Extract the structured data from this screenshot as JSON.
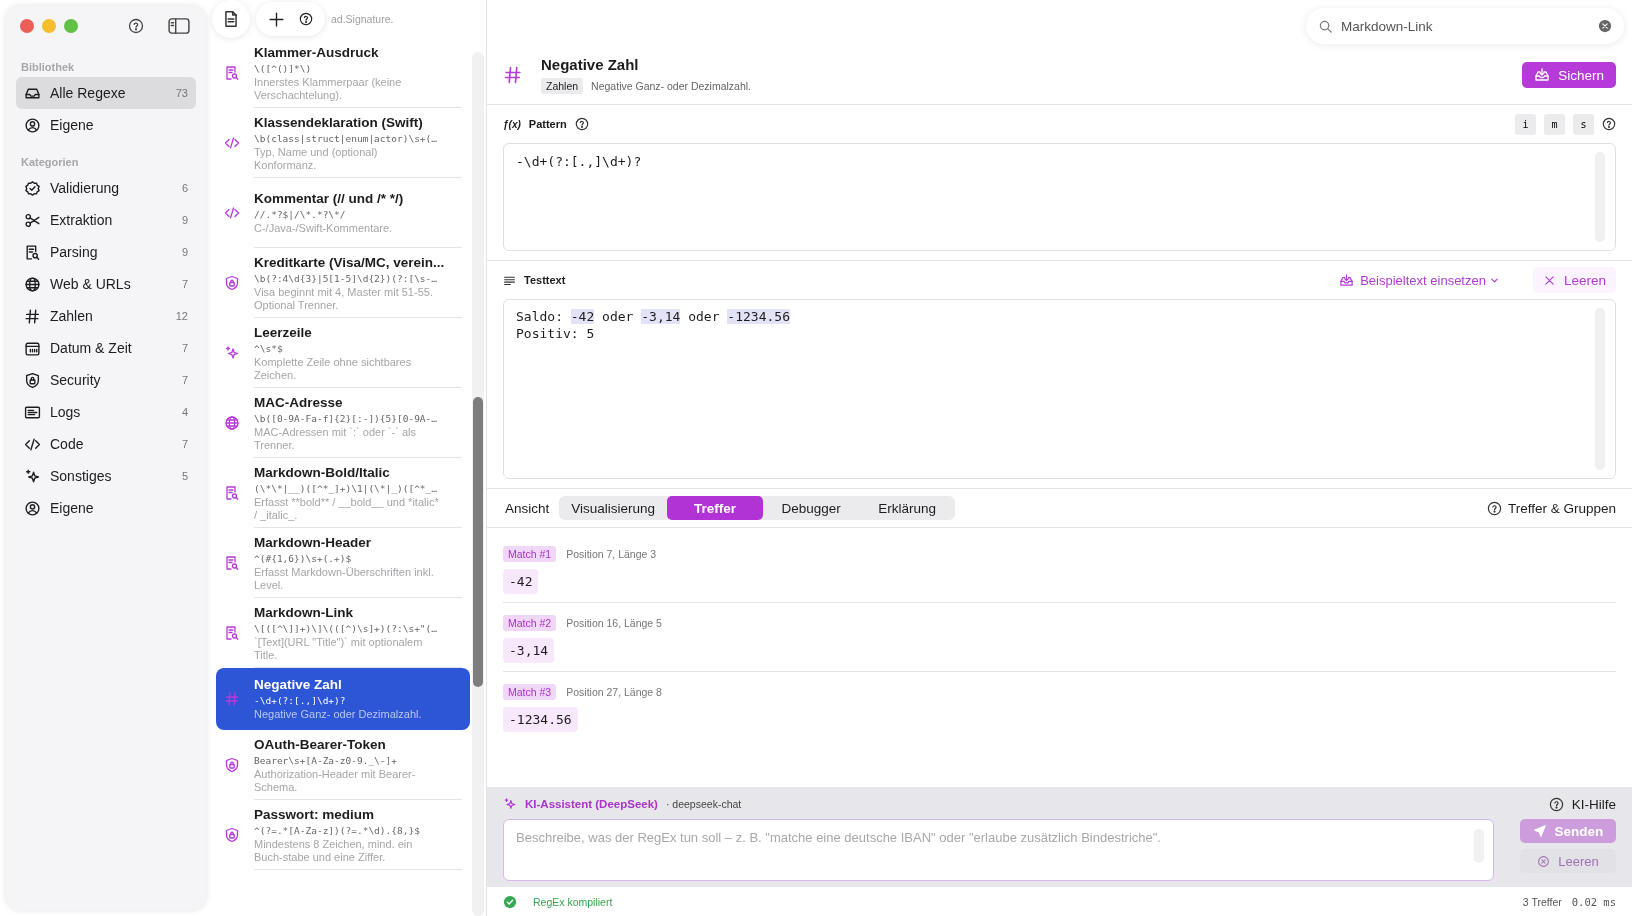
{
  "sidebar": {
    "sections": [
      {
        "title": "Bibliothek",
        "items": [
          {
            "label": "Alle Regexe",
            "count": "73",
            "selected": true
          },
          {
            "label": "Eigene",
            "selected": false
          }
        ]
      },
      {
        "title": "Kategorien",
        "items": [
          {
            "label": "Validierung",
            "count": "6",
            "selected": false
          },
          {
            "label": "Extraktion",
            "count": "9",
            "selected": false
          },
          {
            "label": "Parsing",
            "count": "9",
            "selected": false
          },
          {
            "label": "Web & URLs",
            "count": "7",
            "selected": false
          },
          {
            "label": "Zahlen",
            "count": "12",
            "selected": false
          },
          {
            "label": "Datum & Zeit",
            "count": "7",
            "selected": false
          },
          {
            "label": "Security",
            "count": "7",
            "selected": false
          },
          {
            "label": "Logs",
            "count": "4",
            "selected": false
          },
          {
            "label": "Code",
            "count": "7",
            "selected": false
          },
          {
            "label": "Sonstiges",
            "count": "5",
            "selected": false
          },
          {
            "label": "Eigene",
            "selected": false
          }
        ]
      }
    ]
  },
  "list": {
    "top_fragment": "ad.Signature.",
    "items": [
      {
        "kind": "parsing",
        "title": "Klammer-Ausdruck",
        "pattern": "\\([^()]*\\)",
        "description": "Innerstes Klammerpaar (keine Verschachtelung).",
        "selected": false
      },
      {
        "kind": "code",
        "title": "Klassendeklaration (Swift)",
        "pattern": "\\b(class|struct|enum|actor)\\s+(…",
        "description": "Typ, Name und (optional) Konformanz.",
        "selected": false
      },
      {
        "kind": "code",
        "title": "Kommentar (// und /* */)",
        "pattern": "//.*?$|/\\*.*?\\*/",
        "description": "C-/Java-/Swift-Kommentare.",
        "selected": false
      },
      {
        "kind": "security",
        "title": "Kreditkarte (Visa/MC, verein...",
        "pattern": "\\b(?:4\\d{3}|5[1-5]\\d{2})(?:[\\s-…",
        "description": "Visa beginnt mit 4, Master mit 51-55. Optional Trenner.",
        "selected": false
      },
      {
        "kind": "misc",
        "title": "Leerzeile",
        "pattern": "^\\s*$",
        "description": "Komplette Zeile ohne sichtbares Zeichen.",
        "selected": false
      },
      {
        "kind": "web",
        "title": "MAC-Adresse",
        "pattern": "\\b([0-9A-Fa-f]{2}[:-]){5}[0-9A-…",
        "description": "MAC-Adressen mit `:` oder `-` als Trenner.",
        "selected": false
      },
      {
        "kind": "parsing",
        "title": "Markdown-Bold/Italic",
        "pattern": "(\\*\\*|__)([^*_]+)\\1|(\\*|_)([^*_…",
        "description": "Erfasst **bold** / __bold__ und *italic* / _italic_.",
        "selected": false
      },
      {
        "kind": "parsing",
        "title": "Markdown-Header",
        "pattern": "^(#{1,6})\\s+(.+)$",
        "description": "Erfasst Markdown-Überschriften inkl. Level.",
        "selected": false
      },
      {
        "kind": "parsing",
        "title": "Markdown-Link",
        "pattern": "\\[([^\\]]+)\\]\\(([^)\\s]+)(?:\\s+\"(…",
        "description": "`[Text](URL \"Title\")` mit optionalem Title.",
        "selected": false
      },
      {
        "kind": "number",
        "title": "Negative Zahl",
        "pattern": "-\\d+(?:[.,]\\d+)?",
        "description": "Negative Ganz- oder Dezimalzahl.",
        "selected": true
      },
      {
        "kind": "security",
        "title": "OAuth-Bearer-Token",
        "pattern": "Bearer\\s+[A-Za-z0-9._\\-]+",
        "description": "Authorization-Header mit Bearer-Schema.",
        "selected": false
      },
      {
        "kind": "security",
        "title": "Passwort: medium",
        "pattern": "^(?=.*[A-Za-z])(?=.*\\d).{8,}$",
        "description": "Mindestens 8 Zeichen, mind. ein Buch-stabe und eine Ziffer.",
        "selected": false
      }
    ]
  },
  "search": {
    "value": "Markdown-Link"
  },
  "detail": {
    "title": "Negative Zahl",
    "tag": "Zahlen",
    "description": "Negative Ganz- oder Dezimalzahl.",
    "save": "Sichern"
  },
  "pattern": {
    "icon_text": "ƒ(x)",
    "label": "Pattern",
    "flags": [
      "i",
      "m",
      "s"
    ],
    "value": "-\\d+(?:[.,]\\d+)?"
  },
  "testtext": {
    "label": "Testtext",
    "sample_button": "Beispieltext einsetzen",
    "clear_button": "Leeren",
    "lines": [
      [
        {
          "text": "Saldo: ",
          "match": false
        },
        {
          "text": "-42",
          "match": true
        },
        {
          "text": " oder ",
          "match": false
        },
        {
          "text": "-3,14",
          "match": true
        },
        {
          "text": " oder ",
          "match": false
        },
        {
          "text": "-1234.56",
          "match": true
        }
      ],
      [
        {
          "text": "Positiv: 5",
          "match": false
        }
      ]
    ]
  },
  "view": {
    "label": "Ansicht",
    "tabs": [
      {
        "label": "Visualisierung",
        "selected": false
      },
      {
        "label": "Treffer",
        "selected": true
      },
      {
        "label": "Debugger",
        "selected": false
      },
      {
        "label": "Erklärung",
        "selected": false
      }
    ],
    "help": "Treffer & Gruppen"
  },
  "matches": [
    {
      "badge": "Match #1",
      "info": "Position 7, Länge 3",
      "value": "-42"
    },
    {
      "badge": "Match #2",
      "info": "Position 16, Länge 5",
      "value": "-3,14"
    },
    {
      "badge": "Match #3",
      "info": "Position 27, Länge 8",
      "value": "-1234.56"
    }
  ],
  "assistant": {
    "title": "KI-Assistent (DeepSeek)",
    "model": "· deepseek-chat",
    "help": "KI-Hilfe",
    "placeholder": "Beschreibe, was der RegEx tun soll – z. B. \"matche eine deutsche IBAN\" oder \"erlaube zusätzlich Bindestriche\".",
    "send": {
      "label": "Senden",
      "disabled": true
    },
    "clear": {
      "label": "Leeren",
      "disabled": true
    }
  },
  "status": {
    "message": "RegEx kompiliert",
    "count": "3 Treffer",
    "time": "0.02 ms"
  }
}
